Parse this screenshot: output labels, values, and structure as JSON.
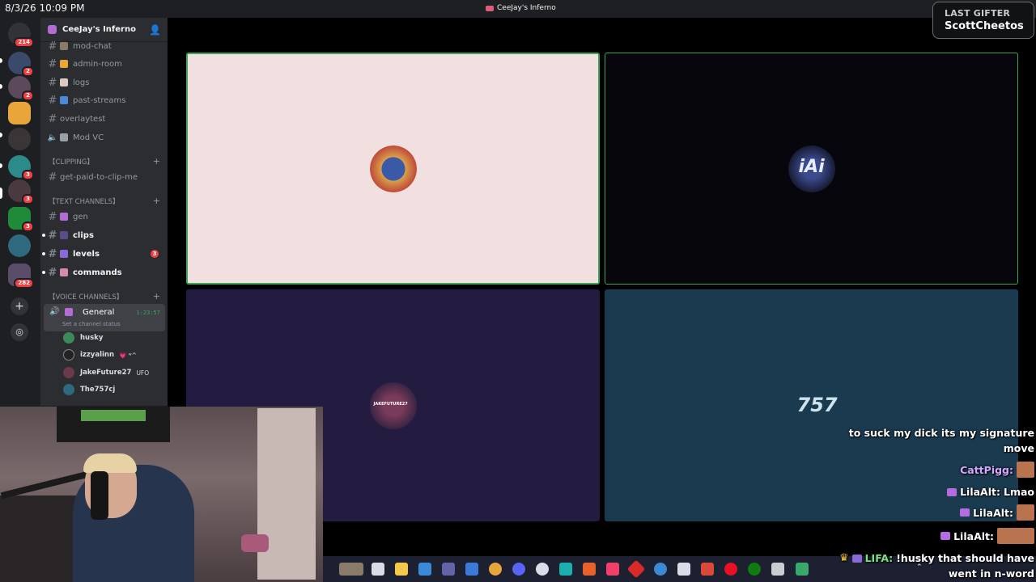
{
  "titlebar": {
    "clock": "8/3/26 10:09 PM",
    "window_title": "CeeJay's Inferno"
  },
  "gifter": {
    "label": "LAST GIFTER",
    "name": "ScottCheetos"
  },
  "rail": {
    "badges": [
      "214",
      "2",
      "2",
      "3",
      "3",
      "3",
      "282"
    ],
    "add_label": "+"
  },
  "guild": {
    "name": "CeeJay's Inferno"
  },
  "channels": {
    "mod_chat": "mod-chat",
    "admin_room": "admin-room",
    "logs": "logs",
    "past_streams": "past-streams",
    "overlaytest": "overlaytest",
    "mod_vc": "Mod VC",
    "cat_clipping": "【CLIPPING】",
    "get_paid": "get-paid-to-clip-me",
    "cat_text": "【TEXT CHANNELS】",
    "gen": "gen",
    "clips": "clips",
    "levels": "levels",
    "levels_badge": "3",
    "commands": "commands",
    "cat_voice": "【VOICE CHANNELS】",
    "general": "General",
    "general_time": "1:23:57",
    "general_status": "Set a channel status"
  },
  "voice_users": [
    {
      "name": "husky",
      "tag": ""
    },
    {
      "name": "izzyalinn",
      "tag": "💗 ʷ^"
    },
    {
      "name": "JakeFuture27",
      "tag": "UFO"
    },
    {
      "name": "The757cj",
      "tag": ""
    }
  ],
  "tiles": [
    {
      "label": "husky-tile"
    },
    {
      "label": "iai-tile"
    },
    {
      "label": "jakefuture27-tile",
      "avatar_text": "JAKEFUTURE27"
    },
    {
      "label": "757-tile",
      "avatar_text": "757"
    }
  ],
  "chat": [
    {
      "user": "",
      "text": "to suck my dick its my signature"
    },
    {
      "user": "",
      "text": "move"
    },
    {
      "user": "CattPigg:",
      "text": ""
    },
    {
      "user": "LilaAlt:",
      "text": "Lmao"
    },
    {
      "user": "LilaAlt:",
      "text": ""
    },
    {
      "user": "LilaAlt:",
      "text": ""
    },
    {
      "user": "LIFA:",
      "text": "!husky that should have"
    },
    {
      "user": "",
      "text": "went in n-word"
    }
  ],
  "colors": {
    "speaking_green": "#3ba55c",
    "mention_red": "#f23f43",
    "sidebar_bg": "#2b2d31"
  }
}
